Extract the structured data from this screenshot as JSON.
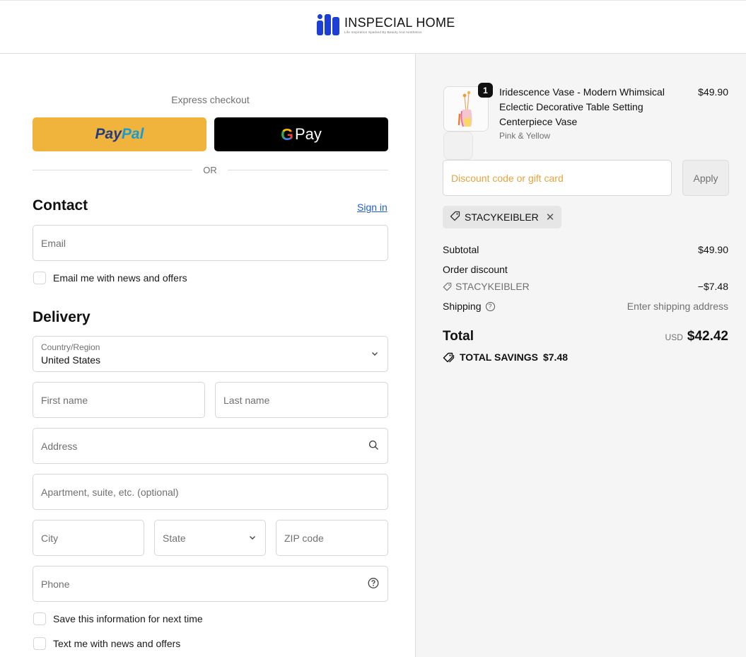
{
  "header": {
    "brand_name": "INSPECIAL HOME",
    "brand_tagline": "Life Inspiration Sparked By Beauty And Aesthetics"
  },
  "express": {
    "title": "Express checkout",
    "paypal_a": "Pay",
    "paypal_b": "Pal",
    "gpay_g": "G",
    "gpay_label": "Pay",
    "or_label": "OR"
  },
  "contact": {
    "heading": "Contact",
    "sign_in": "Sign in",
    "email_placeholder": "Email",
    "news_offers": "Email me with news and offers"
  },
  "delivery": {
    "heading": "Delivery",
    "country_label": "Country/Region",
    "country_value": "United States",
    "first_name": "First name",
    "last_name": "Last name",
    "address": "Address",
    "apartment": "Apartment, suite, etc. (optional)",
    "city": "City",
    "state": "State",
    "zip": "ZIP code",
    "phone": "Phone",
    "save_info": "Save this information for next time",
    "text_offers": "Text me with news and offers"
  },
  "order": {
    "product": {
      "quantity": "1",
      "name": "Iridescence Vase - Modern Whimsical Eclectic Decorative Table Setting Centerpiece Vase",
      "variant": "Pink & Yellow",
      "price": "$49.90"
    },
    "discount_placeholder": "Discount code or gift card",
    "apply_label": "Apply",
    "applied_code": "STACYKEIBLER",
    "subtotal_label": "Subtotal",
    "subtotal_value": "$49.90",
    "order_discount_label": "Order discount",
    "discount_code": "STACYKEIBLER",
    "discount_value": "−$7.48",
    "shipping_label": "Shipping",
    "shipping_value": "Enter shipping address",
    "total_label": "Total",
    "total_currency": "USD",
    "total_value": "$42.42",
    "savings_label": "TOTAL SAVINGS",
    "savings_value": "$7.48"
  },
  "colors": {
    "paypal_bg": "#f0b43c",
    "link": "#1f5bd6",
    "brand_blue": "#1d3fd6",
    "discount_placeholder": "#e8a33d"
  }
}
